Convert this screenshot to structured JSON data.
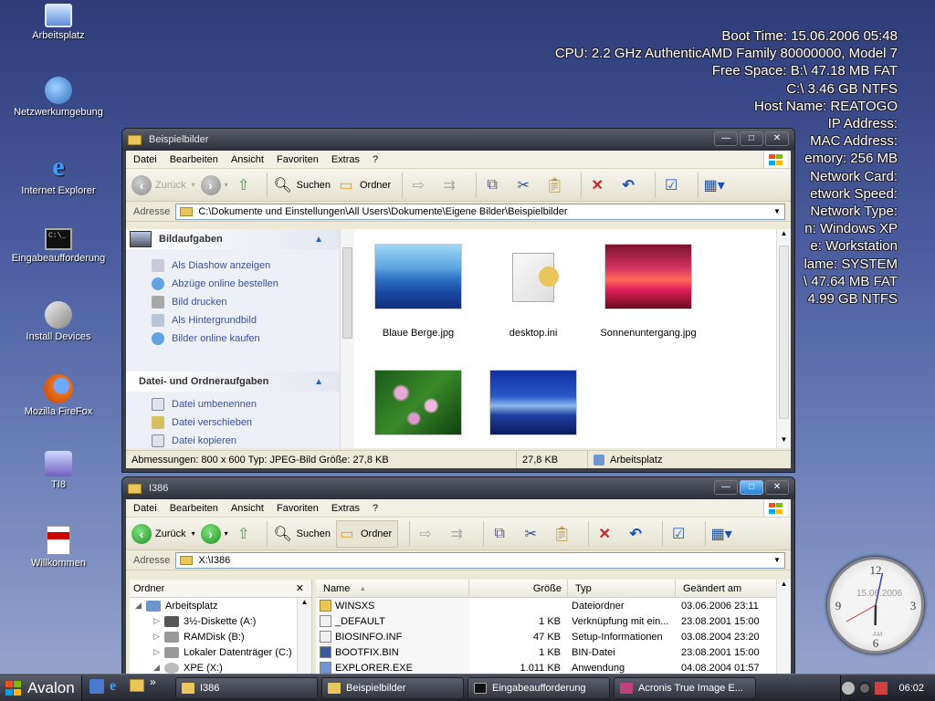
{
  "desktop": {
    "icons": [
      {
        "label": "Arbeitsplatz",
        "icon": "my-computer-icon"
      },
      {
        "label": "Netzwerkumgebung",
        "icon": "network-icon"
      },
      {
        "label": "Internet Explorer",
        "icon": "ie-icon"
      },
      {
        "label": "Eingabeaufforderung",
        "icon": "cmd-icon"
      },
      {
        "label": "Install Devices",
        "icon": "install-devices-icon"
      },
      {
        "label": "Mozilla FireFox",
        "icon": "firefox-icon"
      },
      {
        "label": "TI8",
        "icon": "ti8-icon"
      },
      {
        "label": "Willkommen",
        "icon": "pdf-icon"
      }
    ],
    "cmd_glyph": "C:\\_"
  },
  "sysinfo": [
    "Boot Time: 15.06.2006 05:48",
    "CPU: 2.2 GHz AuthenticAMD Family 80000000, Model 7",
    "Free Space: B:\\ 47.18 MB FAT",
    "C:\\ 3.46 GB NTFS",
    "Host Name: REATOGO",
    "IP Address:",
    "MAC Address:",
    "emory: 256 MB",
    "Network Card:",
    "etwork Speed:",
    "Network Type:",
    "n: Windows XP",
    "e: Workstation",
    "lame: SYSTEM",
    "\\ 47.64 MB FAT",
    "4.99 GB NTFS"
  ],
  "menu": [
    "Datei",
    "Bearbeiten",
    "Ansicht",
    "Favoriten",
    "Extras",
    "?"
  ],
  "toolbar": {
    "back": "Zurück",
    "search": "Suchen",
    "folders": "Ordner",
    "address_label": "Adresse"
  },
  "win1": {
    "title": "Beispielbilder",
    "address": "C:\\Dokumente und Einstellungen\\All Users\\Dokumente\\Eigene Bilder\\Beispielbilder",
    "image_tasks_title": "Bildaufgaben",
    "image_tasks": [
      "Als Diashow anzeigen",
      "Abzüge online bestellen",
      "Bild drucken",
      "Als Hintergrundbild",
      "Bilder online kaufen"
    ],
    "file_tasks_title": "Datei- und Ordneraufgaben",
    "file_tasks": [
      "Datei umbenennen",
      "Datei verschieben",
      "Datei kopieren"
    ],
    "thumbs": [
      {
        "name": "Blaue Berge.jpg"
      },
      {
        "name": "desktop.ini"
      },
      {
        "name": "Sonnenuntergang.jpg"
      },
      {
        "name": ""
      },
      {
        "name": ""
      }
    ],
    "status": {
      "info": "Abmessungen: 800 x 600 Typ: JPEG-Bild Größe: 27,8 KB",
      "size": "27,8 KB",
      "location": "Arbeitsplatz"
    }
  },
  "win2": {
    "title": "I386",
    "address": "X:\\I386",
    "tree_title": "Ordner",
    "tree_close": "✕",
    "tree": [
      {
        "label": "Arbeitsplatz",
        "level": 0,
        "exp": "◢"
      },
      {
        "label": "3½-Diskette (A:)",
        "level": 1,
        "exp": "▷"
      },
      {
        "label": "RAMDisk (B:)",
        "level": 1,
        "exp": "▷"
      },
      {
        "label": "Lokaler Datenträger (C:)",
        "level": 1,
        "exp": "▷"
      },
      {
        "label": "XPE (X:)",
        "level": 1,
        "exp": "◢"
      }
    ],
    "columns": {
      "name": "Name",
      "size": "Größe",
      "type": "Typ",
      "modified": "Geändert am"
    },
    "files": [
      {
        "name": "WINSXS",
        "size": "",
        "type": "Dateiordner",
        "modified": "03.06.2006 23:11"
      },
      {
        "name": "_DEFAULT",
        "size": "1 KB",
        "type": "Verknüpfung mit ein...",
        "modified": "23.08.2001 15:00"
      },
      {
        "name": "BIOSINFO.INF",
        "size": "47 KB",
        "type": "Setup-Informationen",
        "modified": "03.08.2004 23:20"
      },
      {
        "name": "BOOTFIX.BIN",
        "size": "1 KB",
        "type": "BIN-Datei",
        "modified": "23.08.2001 15:00"
      },
      {
        "name": "EXPLORER.EXE",
        "size": "1.011 KB",
        "type": "Anwendung",
        "modified": "04.08.2004 01:57"
      }
    ]
  },
  "taskbar": {
    "start_label": "Avalon",
    "more": "»",
    "buttons": [
      "I386",
      "Beispielbilder",
      "Eingabeaufforderung",
      "Acronis True Image E..."
    ],
    "time": "06:02"
  },
  "clock": {
    "date": "15.06.2006",
    "am": "AM",
    "n12": "12",
    "n3": "3",
    "n6": "6",
    "n9": "9",
    "hour": 6,
    "minute": 2
  }
}
